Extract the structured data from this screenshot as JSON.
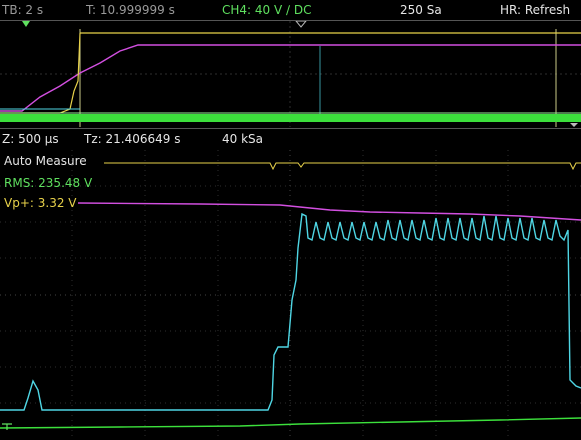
{
  "header": {
    "timebase": "TB: 2 s",
    "trigger_time": "T: 10.999999 s",
    "channel_setting": "CH4: 40 V ∕ DC",
    "sample_count": "250 Sa",
    "hr_mode": "HR: Refresh"
  },
  "zoom_bar": {
    "zoom": "Z: 500 µs",
    "zoom_time": "Tz: 21.406649 s",
    "zoom_rate": "40 kSa"
  },
  "measurements": {
    "title": "Auto Measure",
    "rms": "RMS: 235.48 V",
    "vp": "Vp+: 3.32 V"
  },
  "colors": {
    "ch4_green": "#3ce03c",
    "cyan": "#4fd6e4",
    "magenta": "#d24fe0",
    "yellow": "#e8d24a",
    "grid": "#3a3a3a"
  },
  "icons": {
    "trigger_marker": "orange-triangle-marker",
    "trigger_position": "hollow-triangle-marker",
    "ground_marker": "ground-marker"
  }
}
